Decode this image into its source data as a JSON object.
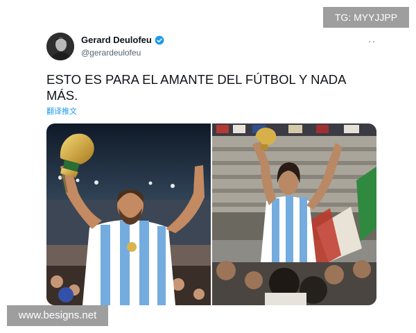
{
  "watermarks": {
    "top_right": "TG: MYYJJPP",
    "bottom_left": "www.besigns.net"
  },
  "tweet": {
    "author_name": "Gerard Deulofeu",
    "author_handle": "@gerardeulofeu",
    "text": "ESTO ES PARA EL AMANTE DEL FÚTBOL Y NADA MÁS.",
    "translate_label": "翻译推文",
    "more_label": "··",
    "verified": true,
    "accent_color": "#1d9bf0"
  },
  "media": {
    "photo_count": 2,
    "photos": [
      {
        "subject": "player-in-argentina-kit-lifting-trophy-modern-stadium"
      },
      {
        "subject": "player-in-argentina-kit-lifting-trophy-vintage-crowd"
      }
    ]
  }
}
